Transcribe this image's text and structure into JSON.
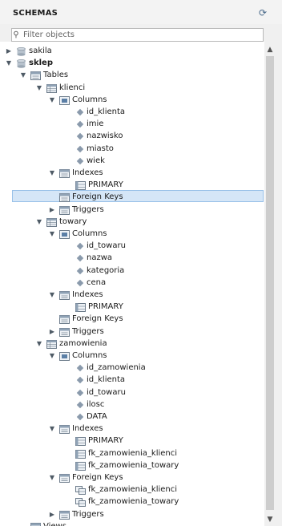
{
  "header": {
    "title": "SCHEMAS"
  },
  "filter": {
    "placeholder": "Filter objects"
  },
  "tree": [
    {
      "label": "sakila",
      "type": "schema",
      "depth": 0,
      "state": "collapsed"
    },
    {
      "label": "sklep",
      "type": "schema",
      "depth": 0,
      "state": "expanded",
      "bold": true
    },
    {
      "label": "Tables",
      "type": "folder",
      "depth": 1,
      "state": "expanded"
    },
    {
      "label": "klienci",
      "type": "table",
      "depth": 2,
      "state": "expanded"
    },
    {
      "label": "Columns",
      "type": "columns",
      "depth": 3,
      "state": "expanded"
    },
    {
      "label": "id_klienta",
      "type": "column",
      "depth": 4
    },
    {
      "label": "imie",
      "type": "column",
      "depth": 4
    },
    {
      "label": "nazwisko",
      "type": "column",
      "depth": 4
    },
    {
      "label": "miasto",
      "type": "column",
      "depth": 4
    },
    {
      "label": "wiek",
      "type": "column",
      "depth": 4
    },
    {
      "label": "Indexes",
      "type": "folder",
      "depth": 3,
      "state": "expanded"
    },
    {
      "label": "PRIMARY",
      "type": "index",
      "depth": 4
    },
    {
      "label": "Foreign Keys",
      "type": "folder",
      "depth": 3,
      "state": "none",
      "selected": true
    },
    {
      "label": "Triggers",
      "type": "folder",
      "depth": 3,
      "state": "collapsed"
    },
    {
      "label": "towary",
      "type": "table",
      "depth": 2,
      "state": "expanded"
    },
    {
      "label": "Columns",
      "type": "columns",
      "depth": 3,
      "state": "expanded"
    },
    {
      "label": "id_towaru",
      "type": "column",
      "depth": 4
    },
    {
      "label": "nazwa",
      "type": "column",
      "depth": 4
    },
    {
      "label": "kategoria",
      "type": "column",
      "depth": 4
    },
    {
      "label": "cena",
      "type": "column",
      "depth": 4
    },
    {
      "label": "Indexes",
      "type": "folder",
      "depth": 3,
      "state": "expanded"
    },
    {
      "label": "PRIMARY",
      "type": "index",
      "depth": 4
    },
    {
      "label": "Foreign Keys",
      "type": "folder",
      "depth": 3,
      "state": "none"
    },
    {
      "label": "Triggers",
      "type": "folder",
      "depth": 3,
      "state": "collapsed"
    },
    {
      "label": "zamowienia",
      "type": "table",
      "depth": 2,
      "state": "expanded"
    },
    {
      "label": "Columns",
      "type": "columns",
      "depth": 3,
      "state": "expanded"
    },
    {
      "label": "id_zamowienia",
      "type": "column",
      "depth": 4
    },
    {
      "label": "id_klienta",
      "type": "column",
      "depth": 4
    },
    {
      "label": "id_towaru",
      "type": "column",
      "depth": 4
    },
    {
      "label": "ilosc",
      "type": "column",
      "depth": 4
    },
    {
      "label": "DATA",
      "type": "column",
      "depth": 4
    },
    {
      "label": "Indexes",
      "type": "folder",
      "depth": 3,
      "state": "expanded"
    },
    {
      "label": "PRIMARY",
      "type": "index",
      "depth": 4
    },
    {
      "label": "fk_zamowienia_klienci",
      "type": "index",
      "depth": 4
    },
    {
      "label": "fk_zamowienia_towary",
      "type": "index",
      "depth": 4
    },
    {
      "label": "Foreign Keys",
      "type": "folder",
      "depth": 3,
      "state": "expanded"
    },
    {
      "label": "fk_zamowienia_klienci",
      "type": "fk",
      "depth": 4
    },
    {
      "label": "fk_zamowienia_towary",
      "type": "fk",
      "depth": 4
    },
    {
      "label": "Triggers",
      "type": "folder",
      "depth": 3,
      "state": "collapsed"
    },
    {
      "label": "Views",
      "type": "folder",
      "depth": 1,
      "state": "none"
    }
  ],
  "colors": {
    "selection_fill": "#d5e6f7",
    "selection_border": "#99c1e8",
    "icon_blue": "#5b7fa6",
    "column_diamond": "#8a9aac"
  }
}
